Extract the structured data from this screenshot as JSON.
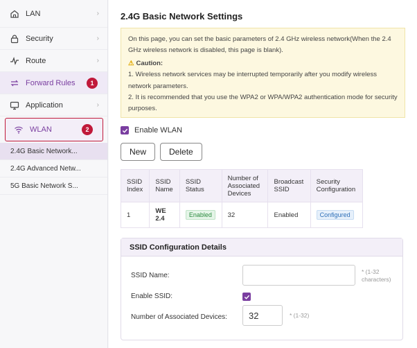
{
  "sidebar": {
    "items": [
      {
        "label": "LAN",
        "icon": "home-icon"
      },
      {
        "label": "Security",
        "icon": "lock-icon"
      },
      {
        "label": "Route",
        "icon": "route-icon"
      },
      {
        "label": "Forward Rules",
        "icon": "forward-arrows-icon",
        "badge": "1"
      },
      {
        "label": "Application",
        "icon": "monitor-icon"
      },
      {
        "label": "WLAN",
        "icon": "wifi-icon",
        "badge": "2"
      }
    ],
    "sub_items": [
      {
        "label": "2.4G Basic Network..."
      },
      {
        "label": "2.4G Advanced Netw..."
      },
      {
        "label": "5G Basic Network S..."
      }
    ]
  },
  "main": {
    "title": "2.4G Basic Network Settings",
    "notice": {
      "intro": "On this page, you can set the basic parameters of 2.4 GHz wireless network(When the 2.4 GHz wireless network is disabled, this page is blank).",
      "caution_title": "Caution:",
      "line1": "1. Wireless network services may be interrupted temporarily after you modify wireless network parameters.",
      "line2": "2. It is recommended that you use the WPA2 or WPA/WPA2 authentication mode for security purposes."
    },
    "enable_wlan_label": "Enable WLAN",
    "new_button": "New",
    "delete_button": "Delete",
    "table": {
      "headers": [
        "SSID Index",
        "SSID Name",
        "SSID Status",
        "Number of Associated Devices",
        "Broadcast SSID",
        "Security Configuration"
      ],
      "rows": [
        {
          "index": "1",
          "name": "WE 2.4",
          "status": "Enabled",
          "devices": "32",
          "broadcast": "Enabled",
          "security": "Configured"
        }
      ]
    },
    "details": {
      "title": "SSID Configuration Details",
      "ssid_name_label": "SSID Name:",
      "ssid_name_value": "",
      "ssid_name_hint": "* (1-32 characters)",
      "enable_ssid_label": "Enable SSID:",
      "devices_label": "Number of Associated Devices:",
      "devices_value": "32",
      "devices_hint": "* (1-32)"
    }
  },
  "colors": {
    "accent": "#7a3ea0",
    "badge": "#c0193a",
    "notice_bg": "#fdf8e0"
  }
}
